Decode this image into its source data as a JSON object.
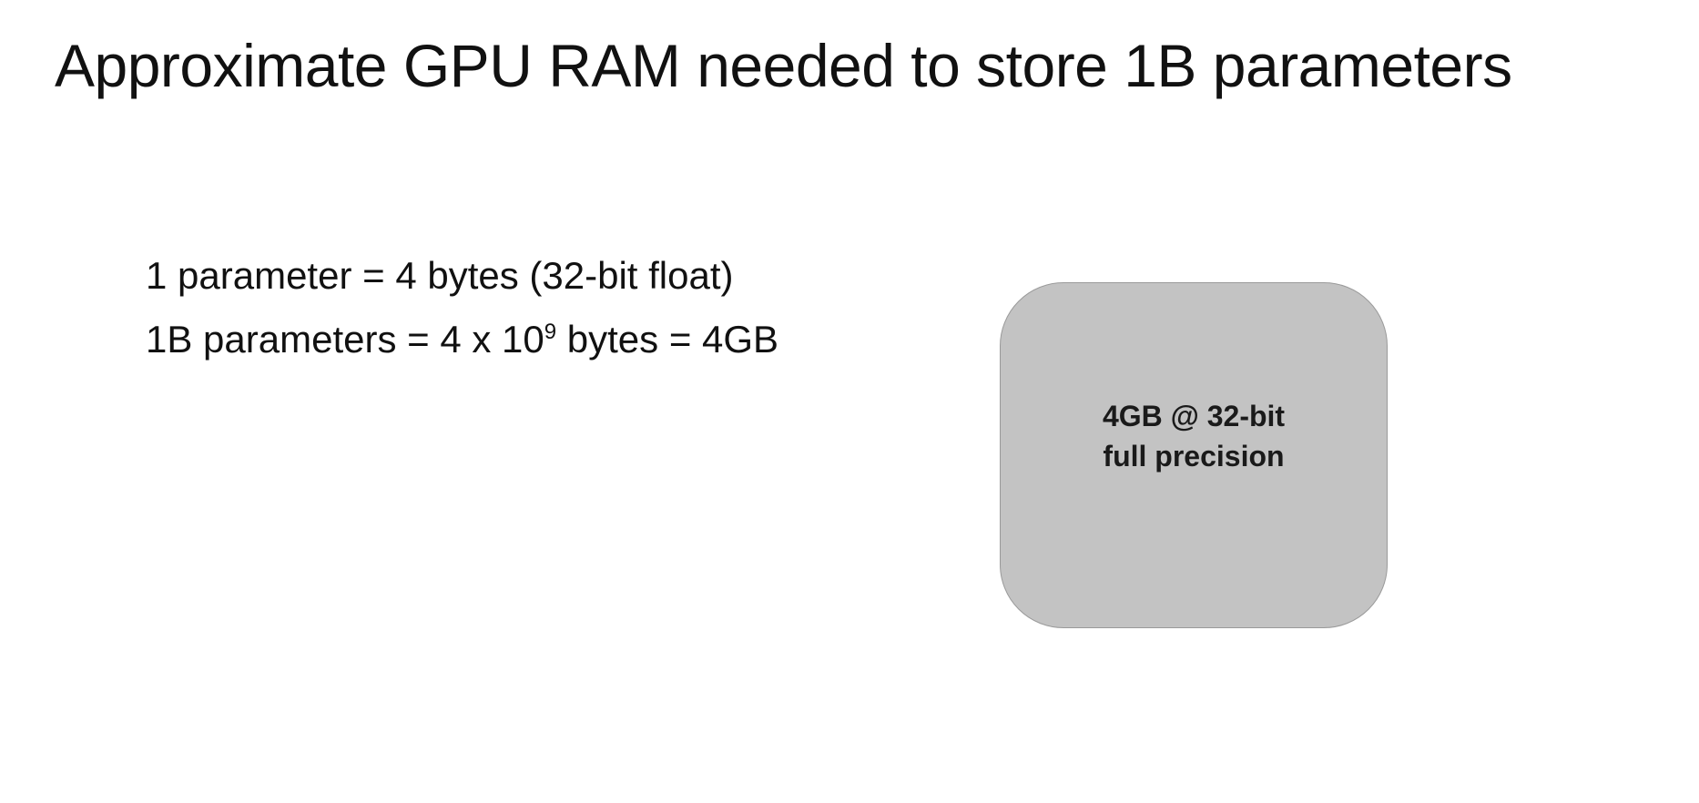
{
  "slide": {
    "title": "Approximate GPU RAM needed to store 1B parameters"
  },
  "facts": {
    "line1": "1 parameter = 4 bytes (32-bit float)",
    "line2_before_exponent": "1B parameters = 4 x 10",
    "line2_exponent": "9",
    "line2_after_exponent": " bytes = 4GB"
  },
  "memory_block": {
    "label_line1": "4GB @ 32-bit",
    "label_line2": "full precision",
    "fill_color": "#c3c3c3"
  }
}
